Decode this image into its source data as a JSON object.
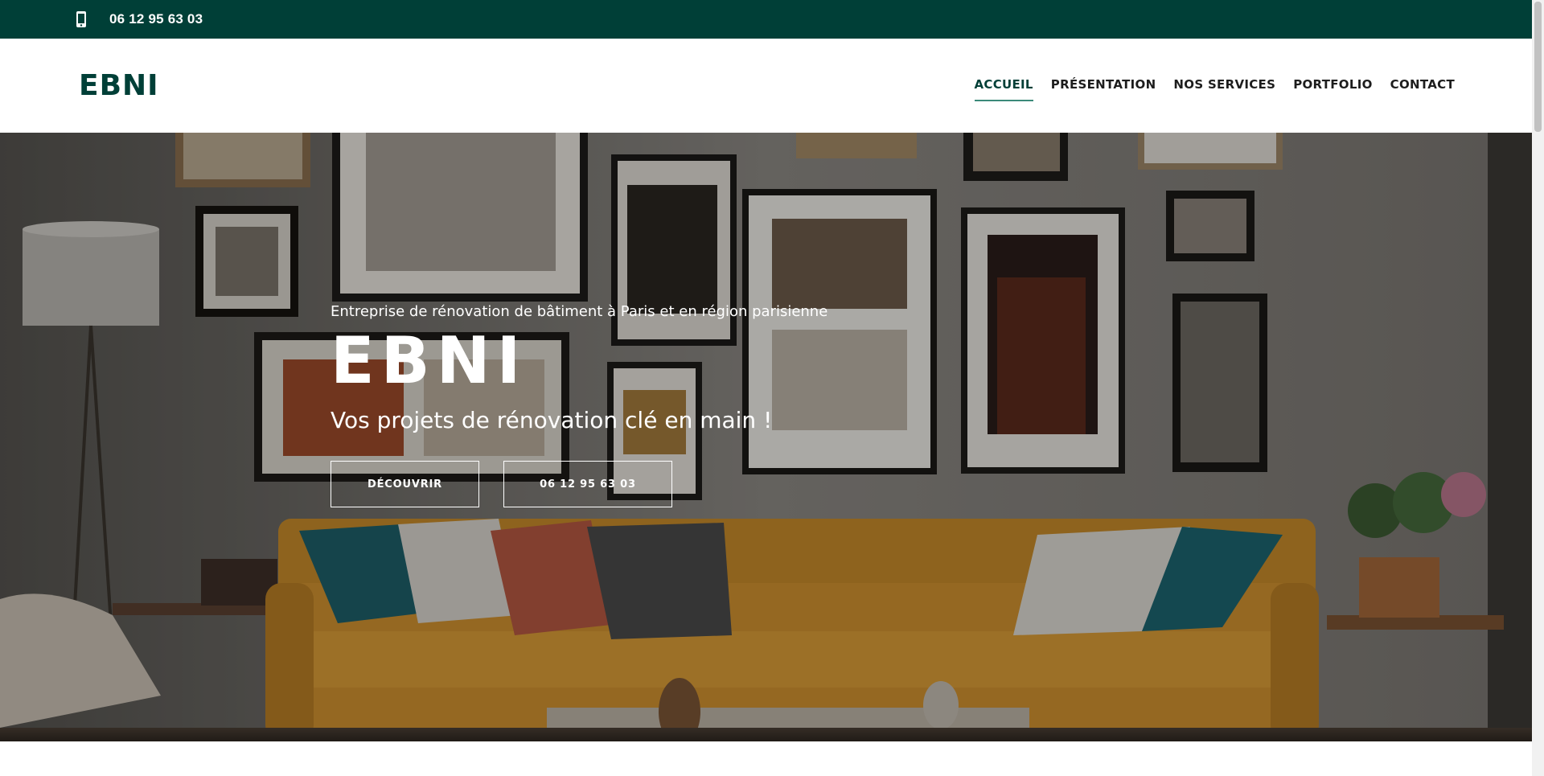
{
  "topbar": {
    "phone": "06 12 95 63 03",
    "icon": "phone-icon",
    "bg": "#003f37"
  },
  "header": {
    "logo": "EBNI",
    "nav": [
      {
        "label": "ACCUEIL",
        "active": true
      },
      {
        "label": "PRÉSENTATION"
      },
      {
        "label": "NOS SERVICES"
      },
      {
        "label": "PORTFOLIO"
      },
      {
        "label": "CONTACT"
      }
    ]
  },
  "hero": {
    "tagline": "Entreprise de rénovation de bâtiment à Paris et en région parisienne",
    "title": "EBNI",
    "subtitle": "Vos projets de rénovation clé en main !",
    "buttons": {
      "discover": "DÉCOUVRIR",
      "phone": "06 12 95 63 03"
    }
  },
  "colors": {
    "brand": "#003f37",
    "accent": "#3b8a7a"
  }
}
